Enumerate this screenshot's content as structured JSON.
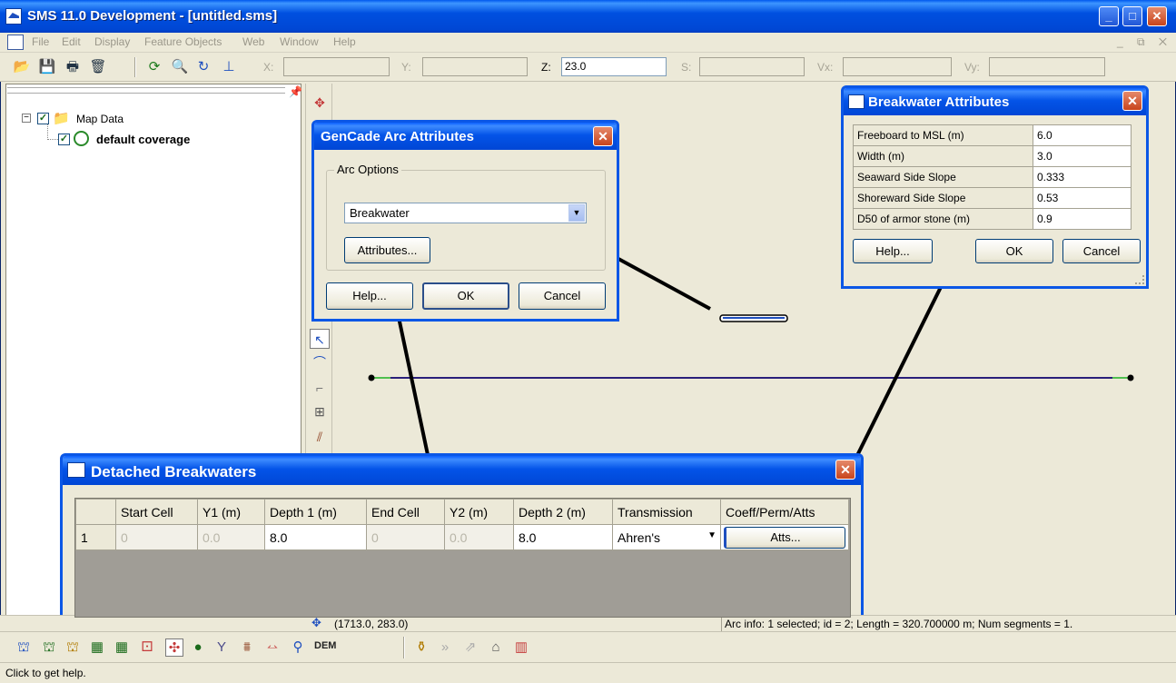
{
  "app": {
    "title": "SMS 11.0 Development - [untitled.sms]",
    "min_label": "_",
    "max_label": "□",
    "close_label": "✕"
  },
  "menu": [
    "File",
    "Edit",
    "Display",
    "Feature Objects",
    "Web",
    "Window",
    "Help"
  ],
  "mdi_controls": "_ ⧉ ✕",
  "coords": {
    "x_label": "X:",
    "x_value": "",
    "y_label": "Y:",
    "y_value": "",
    "z_label": "Z:",
    "z_value": "23.0",
    "s_label": "S:",
    "s_value": "",
    "vx_label": "Vx:",
    "vx_value": "",
    "vy_label": "Vy:",
    "vy_value": ""
  },
  "tree": {
    "root_label": "Map Data",
    "child_label": "default coverage",
    "expand_glyph": "−",
    "check_glyph": "✓"
  },
  "gencade_dialog": {
    "title": "GenCade Arc Attributes",
    "group_label": "Arc Options",
    "selected_option": "Breakwater",
    "attributes_button": "Attributes...",
    "help_button": "Help...",
    "ok_button": "OK",
    "cancel_button": "Cancel"
  },
  "breakwater_dialog": {
    "title": "Breakwater Attributes",
    "rows": [
      {
        "label": "Freeboard to MSL (m)",
        "value": "6.0"
      },
      {
        "label": "Width (m)",
        "value": "3.0"
      },
      {
        "label": "Seaward Side Slope",
        "value": "0.333"
      },
      {
        "label": "Shoreward Side Slope",
        "value": "0.53"
      },
      {
        "label": "D50 of armor stone (m)",
        "value": "0.9"
      }
    ],
    "help_button": "Help...",
    "ok_button": "OK",
    "cancel_button": "Cancel"
  },
  "detached_dialog": {
    "title": "Detached Breakwaters",
    "columns": [
      "",
      "Start Cell",
      "Y1 (m)",
      "Depth 1 (m)",
      "End Cell",
      "Y2 (m)",
      "Depth 2 (m)",
      "Transmission",
      "Coeff/Perm/Atts"
    ],
    "row": {
      "index": "1",
      "start_cell": "0",
      "y1": "0.0",
      "depth1": "8.0",
      "end_cell": "0",
      "y2": "0.0",
      "depth2": "8.0",
      "transmission": "Ahren's",
      "atts_button": "Atts..."
    }
  },
  "status": {
    "coords": "(1713.0, 283.0)",
    "arc_info": "Arc info: 1 selected; id = 2; Length = 320.700000 m; Num segments = 1.",
    "help_text": "Click to get help.",
    "dem_label": "DEM"
  },
  "colors": {
    "titlebar": "#0047d4",
    "arc_line": "#2a1f7a",
    "arrow": "#000000"
  }
}
